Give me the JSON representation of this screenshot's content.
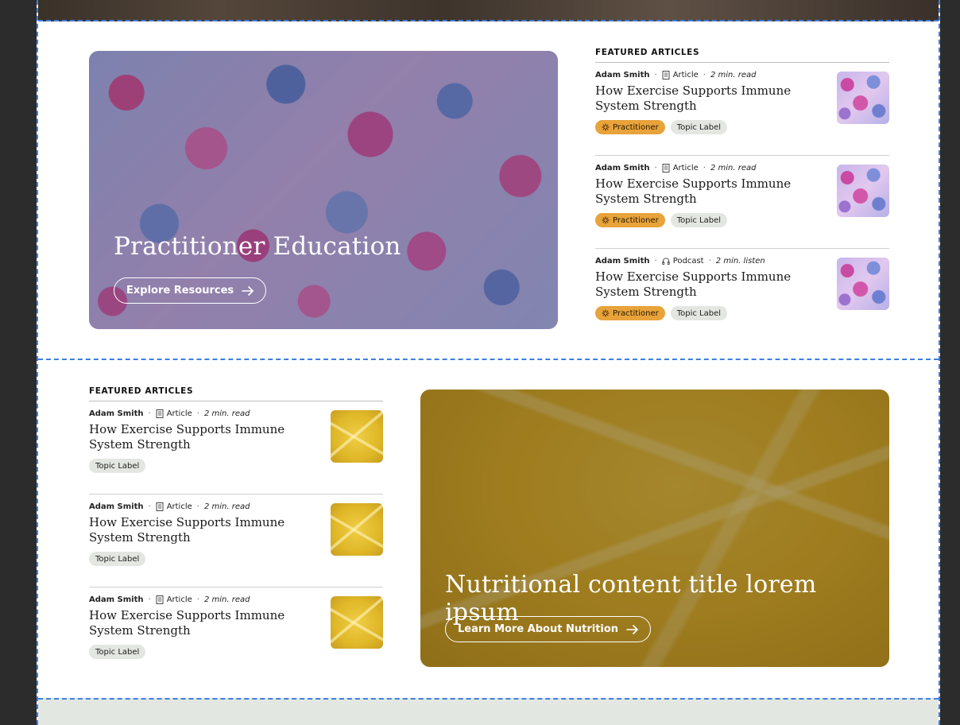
{
  "hero_practitioner": {
    "title": "Practitioner Education",
    "button_label": "Explore Resources"
  },
  "hero_nutrition": {
    "title": "Nutritional content title lorem ipsum",
    "button_label": "Learn More About Nutrition"
  },
  "featured_top": {
    "heading": "FEATURED ARTICLES",
    "items": [
      {
        "author": "Adam Smith",
        "kind": "Article",
        "kind_icon": "document-icon",
        "duration": "2 min. read",
        "title": "How Exercise Supports Immune System Strength",
        "tag_practitioner": "Practitioner",
        "tag_topic": "Topic Label"
      },
      {
        "author": "Adam Smith",
        "kind": "Article",
        "kind_icon": "document-icon",
        "duration": "2 min. read",
        "title": "How Exercise Supports Immune System Strength",
        "tag_practitioner": "Practitioner",
        "tag_topic": "Topic Label"
      },
      {
        "author": "Adam Smith",
        "kind": "Podcast",
        "kind_icon": "headphones-icon",
        "duration": "2 min. listen",
        "title": "How Exercise Supports Immune System Strength",
        "tag_practitioner": "Practitioner",
        "tag_topic": "Topic Label"
      }
    ]
  },
  "featured_bottom": {
    "heading": "FEATURED ARTICLES",
    "items": [
      {
        "author": "Adam Smith",
        "kind": "Article",
        "kind_icon": "document-icon",
        "duration": "2 min. read",
        "title": "How Exercise Supports Immune System Strength",
        "tag_topic": "Topic Label"
      },
      {
        "author": "Adam Smith",
        "kind": "Article",
        "kind_icon": "document-icon",
        "duration": "2 min. read",
        "title": "How Exercise Supports Immune System Strength",
        "tag_topic": "Topic Label"
      },
      {
        "author": "Adam Smith",
        "kind": "Article",
        "kind_icon": "document-icon",
        "duration": "2 min. read",
        "title": "How Exercise Supports Immune System Strength",
        "tag_topic": "Topic Label"
      }
    ]
  },
  "colors": {
    "page_bg": "#2c2c2c",
    "selection_outline": "#3f7fe0",
    "practitioner_tag": "#e8a33a",
    "topic_tag": "#e3e6e1",
    "bottom_band": "#e2e7e2"
  }
}
